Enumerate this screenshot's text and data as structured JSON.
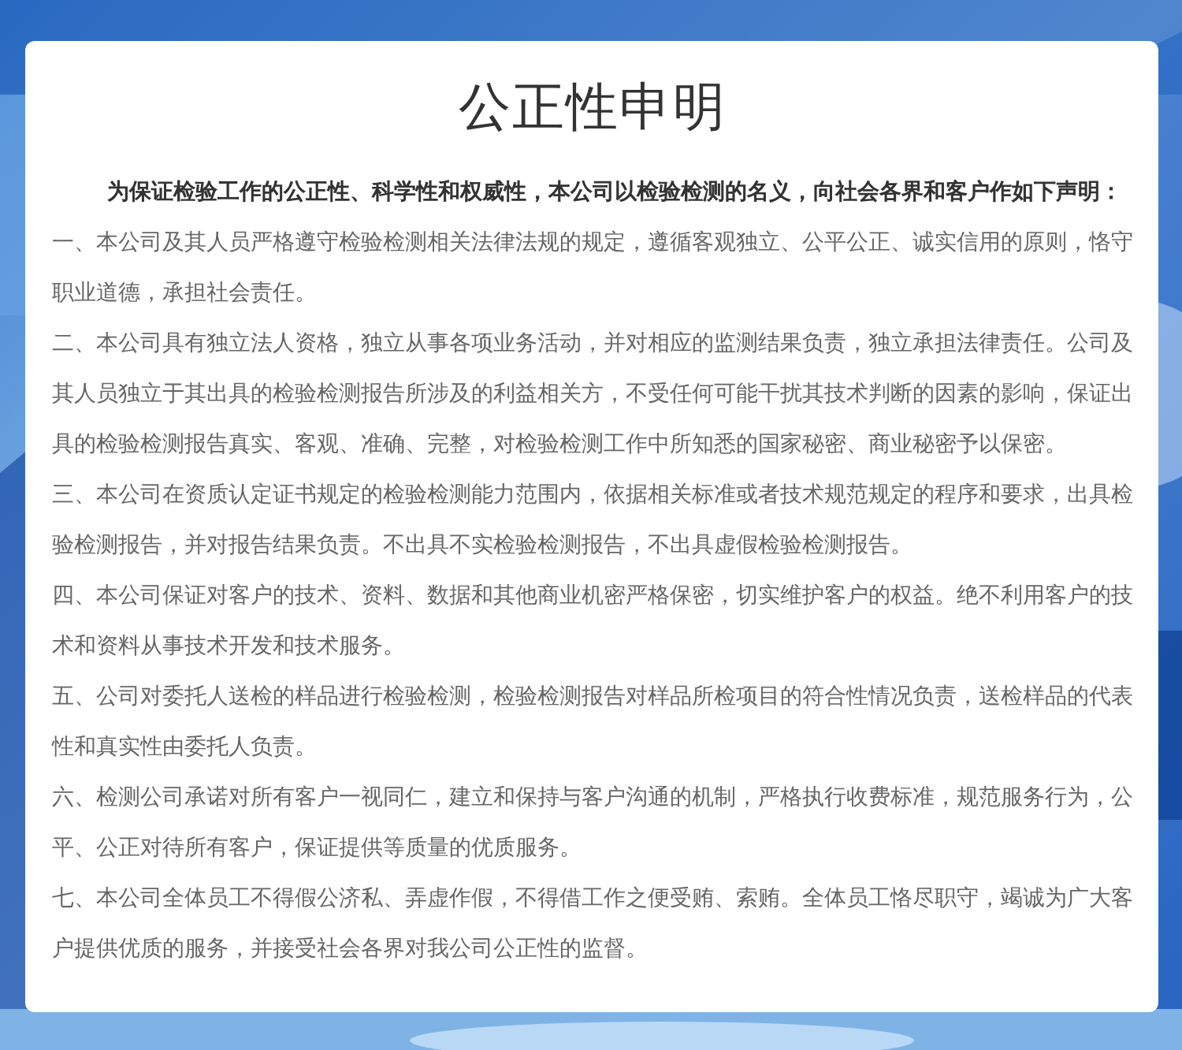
{
  "title": "公正性申明",
  "intro": "为保证检验工作的公正性、科学性和权威性，本公司以检验检测的名义，向社会各界和客户作如下声明：",
  "items": [
    "一、本公司及其人员严格遵守检验检测相关法律法规的规定，遵循客观独立、公平公正、诚实信用的原则，恪守职业道德，承担社会责任。",
    "二、本公司具有独立法人资格，独立从事各项业务活动，并对相应的监测结果负责，独立承担法律责任。公司及其人员独立于其出具的检验检测报告所涉及的利益相关方，不受任何可能干扰其技术判断的因素的影响，保证出具的检验检测报告真实、客观、准确、完整，对检验检测工作中所知悉的国家秘密、商业秘密予以保密。",
    "三、本公司在资质认定证书规定的检验检测能力范围内，依据相关标准或者技术规范规定的程序和要求，出具检验检测报告，并对报告结果负责。不出具不实检验检测报告，不出具虚假检验检测报告。",
    "四、本公司保证对客户的技术、资料、数据和其他商业机密严格保密，切实维护客户的权益。绝不利用客户的技术和资料从事技术开发和技术服务。",
    "五、公司对委托人送检的样品进行检验检测，检验检测报告对样品所检项目的符合性情况负责，送检样品的代表性和真实性由委托人负责。",
    "六、检测公司承诺对所有客户一视同仁，建立和保持与客户沟通的机制，严格执行收费标准，规范服务行为，公平、公正对待所有客户，保证提供等质量的优质服务。",
    "七、本公司全体员工不得假公济私、弄虚作假，不得借工作之便受贿、索贿。全体员工恪尽职守，竭诚为广大客户提供优质的服务，并接受社会各界对我公司公正性的监督。"
  ]
}
